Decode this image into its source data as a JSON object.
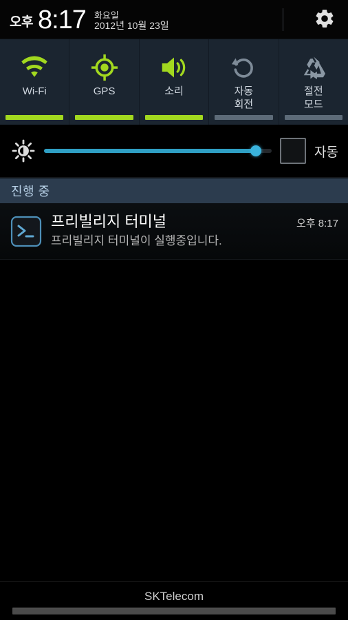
{
  "header": {
    "ampm": "오후",
    "time": "8:17",
    "weekday": "화요일",
    "date": "2012년 10월 23일",
    "settings_icon": "gear-icon"
  },
  "quick_settings": {
    "toggles": [
      {
        "id": "wifi",
        "label": "Wi-Fi",
        "icon": "wifi-icon",
        "state": "on"
      },
      {
        "id": "gps",
        "label": "GPS",
        "icon": "gps-icon",
        "state": "on"
      },
      {
        "id": "sound",
        "label": "소리",
        "icon": "sound-icon",
        "state": "on"
      },
      {
        "id": "autorotate",
        "label": "자동\n회전",
        "icon": "rotate-icon",
        "state": "off"
      },
      {
        "id": "powersave",
        "label": "절전\n모드",
        "icon": "power-save-icon",
        "state": "off"
      }
    ],
    "on_color": "#a2d81f",
    "off_color": "#5d6b78",
    "background": "#1b2530"
  },
  "brightness": {
    "icon": "brightness-icon",
    "value_percent": 93,
    "slider_color": "#2f9fc4",
    "auto_label": "자동",
    "auto_checked": false
  },
  "notification_section": {
    "header": "진행 중",
    "items": [
      {
        "icon": "terminal-icon",
        "title": "프리빌리지 터미널",
        "text": "프리빌리지 터미널이 실행중입니다.",
        "time": "오후 8:17"
      }
    ]
  },
  "footer": {
    "carrier": "SKTelecom"
  }
}
